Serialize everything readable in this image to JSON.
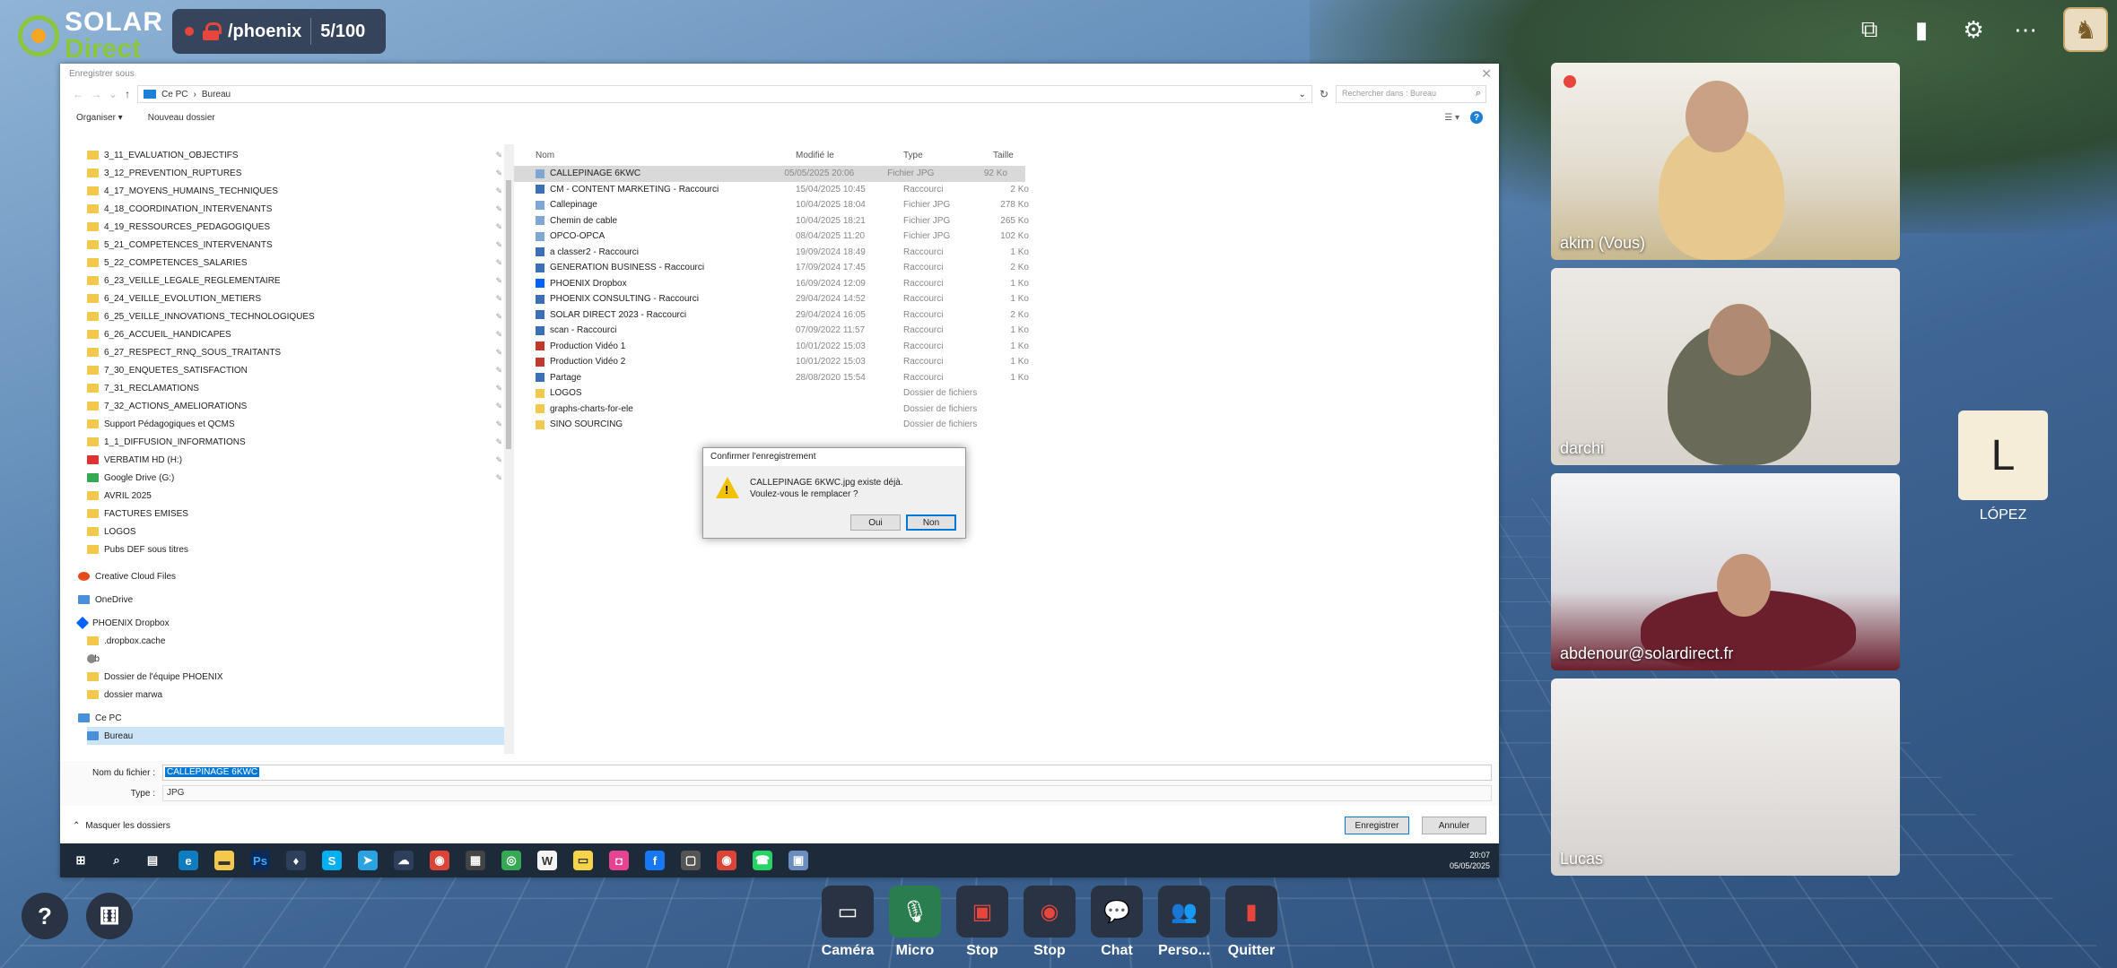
{
  "app": {
    "logo_line1": "SOLAR",
    "logo_line2": "Direct",
    "room_name": "/phoenix",
    "room_count": "5/100"
  },
  "dialog": {
    "title": "Enregistrer sous",
    "breadcrumb": [
      "Ce PC",
      "Bureau"
    ],
    "search_placeholder": "Rechercher dans : Bureau",
    "organize": "Organiser ▾",
    "new_folder": "Nouveau dossier",
    "nav_items": [
      {
        "label": "3_11_EVALUATION_OBJECTIFS",
        "kind": "folder"
      },
      {
        "label": "3_12_PREVENTION_RUPTURES",
        "kind": "folder"
      },
      {
        "label": "4_17_MOYENS_HUMAINS_TECHNIQUES",
        "kind": "folder"
      },
      {
        "label": "4_18_COORDINATION_INTERVENANTS",
        "kind": "folder"
      },
      {
        "label": "4_19_RESSOURCES_PEDAGOGIQUES",
        "kind": "folder"
      },
      {
        "label": "5_21_COMPETENCES_INTERVENANTS",
        "kind": "folder"
      },
      {
        "label": "5_22_COMPETENCES_SALARIES",
        "kind": "folder"
      },
      {
        "label": "6_23_VEILLE_LEGALE_REGLEMENTAIRE",
        "kind": "folder"
      },
      {
        "label": "6_24_VEILLE_EVOLUTION_METIERS",
        "kind": "folder"
      },
      {
        "label": "6_25_VEILLE_INNOVATIONS_TECHNOLOGIQUES",
        "kind": "folder"
      },
      {
        "label": "6_26_ACCUEIL_HANDICAPES",
        "kind": "folder"
      },
      {
        "label": "6_27_RESPECT_RNQ_SOUS_TRAITANTS",
        "kind": "folder"
      },
      {
        "label": "7_30_ENQUETES_SATISFACTION",
        "kind": "folder"
      },
      {
        "label": "7_31_RECLAMATIONS",
        "kind": "folder"
      },
      {
        "label": "7_32_ACTIONS_AMELIORATIONS",
        "kind": "folder"
      },
      {
        "label": "Support Pédagogiques et QCMS",
        "kind": "folder"
      },
      {
        "label": "1_1_DIFFUSION_INFORMATIONS",
        "kind": "folder"
      },
      {
        "label": "VERBATIM HD (H:)",
        "kind": "red"
      },
      {
        "label": "Google Drive (G:)",
        "kind": "green"
      },
      {
        "label": "AVRIL 2025",
        "kind": "folder"
      },
      {
        "label": "FACTURES EMISES",
        "kind": "folder"
      },
      {
        "label": "LOGOS",
        "kind": "folder"
      },
      {
        "label": "Pubs DEF sous titres",
        "kind": "folder"
      }
    ],
    "nav_root_items": [
      {
        "label": "Creative Cloud Files",
        "kind": "cloud"
      },
      {
        "label": "OneDrive",
        "kind": "blue"
      },
      {
        "label": "PHOENIX Dropbox",
        "kind": "drop"
      }
    ],
    "dropbox_items": [
      {
        "label": ".dropbox.cache",
        "kind": "folder"
      },
      {
        "label": "a b",
        "kind": "person"
      },
      {
        "label": "Dossier de l'équipe PHOENIX",
        "kind": "folder"
      },
      {
        "label": "dossier marwa",
        "kind": "folder"
      }
    ],
    "pc_label": "Ce PC",
    "bureau_label": "Bureau",
    "columns": {
      "name": "Nom",
      "date": "Modifié le",
      "type": "Type",
      "size": "Taille"
    },
    "files": [
      {
        "name": "CALLEPINAGE 6KWC",
        "date": "05/05/2025 20:06",
        "type": "Fichier JPG",
        "size": "92 Ko",
        "icon": "img"
      },
      {
        "name": "CM - CONTENT MARKETING - Raccourci",
        "date": "15/04/2025 10:45",
        "type": "Raccourci",
        "size": "2 Ko",
        "icon": "lnk"
      },
      {
        "name": "Callepinage",
        "date": "10/04/2025 18:04",
        "type": "Fichier JPG",
        "size": "278 Ko",
        "icon": "img"
      },
      {
        "name": "Chemin de cable",
        "date": "10/04/2025 18:21",
        "type": "Fichier JPG",
        "size": "265 Ko",
        "icon": "img"
      },
      {
        "name": "OPCO-OPCA",
        "date": "08/04/2025 11:20",
        "type": "Fichier JPG",
        "size": "102 Ko",
        "icon": "img"
      },
      {
        "name": "a classer2 - Raccourci",
        "date": "19/09/2024 18:49",
        "type": "Raccourci",
        "size": "1 Ko",
        "icon": "lnk"
      },
      {
        "name": "GENERATION BUSINESS - Raccourci",
        "date": "17/09/2024 17:45",
        "type": "Raccourci",
        "size": "2 Ko",
        "icon": "lnk"
      },
      {
        "name": "PHOENIX Dropbox",
        "date": "16/09/2024 12:09",
        "type": "Raccourci",
        "size": "1 Ko",
        "icon": "drop"
      },
      {
        "name": "PHOENIX CONSULTING - Raccourci",
        "date": "29/04/2024 14:52",
        "type": "Raccourci",
        "size": "1 Ko",
        "icon": "lnk"
      },
      {
        "name": "SOLAR DIRECT 2023 - Raccourci",
        "date": "29/04/2024 16:05",
        "type": "Raccourci",
        "size": "2 Ko",
        "icon": "lnk"
      },
      {
        "name": "scan - Raccourci",
        "date": "07/09/2022 11:57",
        "type": "Raccourci",
        "size": "1 Ko",
        "icon": "lnk"
      },
      {
        "name": "Production Vidéo 1",
        "date": "10/01/2022 15:03",
        "type": "Raccourci",
        "size": "1 Ko",
        "icon": "vid"
      },
      {
        "name": "Production Vidéo 2",
        "date": "10/01/2022 15:03",
        "type": "Raccourci",
        "size": "1 Ko",
        "icon": "vid"
      },
      {
        "name": "Partage",
        "date": "28/08/2020 15:54",
        "type": "Raccourci",
        "size": "1 Ko",
        "icon": "lnk"
      },
      {
        "name": "LOGOS",
        "date": "",
        "type": "Dossier de fichiers",
        "size": "",
        "icon": "fold"
      },
      {
        "name": "graphs-charts-for-ele",
        "date": "",
        "type": "Dossier de fichiers",
        "size": "",
        "icon": "fold"
      },
      {
        "name": "SINO SOURCING",
        "date": "",
        "type": "Dossier de fichiers",
        "size": "",
        "icon": "fold"
      }
    ],
    "filename_label": "Nom du fichier :",
    "filename_value": "CALLEPINAGE 6KWC",
    "type_label": "Type :",
    "type_value": "JPG",
    "hide_folders": "Masquer les dossiers",
    "save_button": "Enregistrer",
    "cancel_button": "Annuler",
    "clock_time": "20:07",
    "clock_date": "05/05/2025"
  },
  "confirm": {
    "title": "Confirmer l'enregistrement",
    "line1": "CALLEPINAGE 6KWC.jpg existe déjà.",
    "line2": "Voulez-vous le remplacer ?",
    "yes": "Oui",
    "no": "Non"
  },
  "participants": [
    {
      "name": "akim (Vous)"
    },
    {
      "name": "darchi"
    },
    {
      "name": "abdenour@solardirect.fr"
    },
    {
      "name": "Lucas"
    }
  ],
  "side_participant": {
    "initial": "L",
    "name": "LÓPEZ"
  },
  "controls": [
    {
      "label": "Caméra",
      "icon": "camera-icon",
      "glyph": "▭"
    },
    {
      "label": "Micro",
      "icon": "microphone-icon",
      "glyph": "🎙"
    },
    {
      "label": "Stop",
      "icon": "screen-share-icon",
      "glyph": "▣"
    },
    {
      "label": "Stop",
      "icon": "record-icon",
      "glyph": "◉"
    },
    {
      "label": "Chat",
      "icon": "chat-icon",
      "glyph": "💬"
    },
    {
      "label": "Perso...",
      "icon": "people-icon",
      "glyph": "👥"
    },
    {
      "label": "Quitter",
      "icon": "quit-icon",
      "glyph": "▮"
    }
  ],
  "left_buttons": {
    "help": "?",
    "gift": "⚅"
  },
  "colors": {
    "brand_green": "#8cc63f",
    "record_red": "#e8453c",
    "mic_active": "#2a7d4f"
  }
}
